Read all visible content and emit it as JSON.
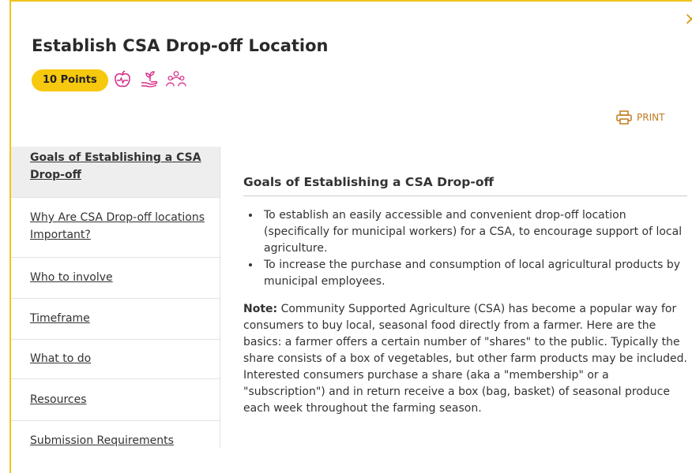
{
  "header": {
    "title": "Establish CSA Drop-off Location",
    "points_badge": "10 Points",
    "close_symbol": "×",
    "category_icons": [
      "apple-health-icon",
      "hand-sprout-icon",
      "community-people-icon"
    ],
    "print_label": "PRINT"
  },
  "sidebar": {
    "items": [
      {
        "label": "Goals of Establishing a CSA Drop-off",
        "active": true
      },
      {
        "label": "Why Are CSA Drop-off locations Important?",
        "active": false
      },
      {
        "label": "Who to involve",
        "active": false
      },
      {
        "label": "Timeframe",
        "active": false
      },
      {
        "label": "What to do",
        "active": false
      },
      {
        "label": "Resources",
        "active": false
      },
      {
        "label": "Submission Requirements",
        "active": false
      }
    ]
  },
  "main": {
    "section_title": "Goals of Establishing a CSA Drop-off",
    "goals": [
      "To establish an easily accessible and convenient drop-off location (specifically for municipal workers) for a CSA, to encourage support of local agriculture.",
      "To increase the purchase and consumption of local agricultural products by municipal employees."
    ],
    "note_label": "Note:",
    "note_text": " Community Supported Agriculture (CSA) has become a popular way for consumers to buy local, seasonal food directly from a farmer. Here are the basics: a farmer offers a certain number of \"shares\" to the public. Typically the share consists of a box of vegetables, but other farm products may be included. Interested consumers purchase a share (aka a \"membership\" or a \"subscription\") and in return receive a box (bag, basket) of seasonal produce each week throughout the farming season."
  },
  "colors": {
    "frame_border": "#f0c419",
    "badge_bg": "#f6c90e",
    "icon_magenta": "#d6338a",
    "print_orange": "#c17a1e"
  }
}
